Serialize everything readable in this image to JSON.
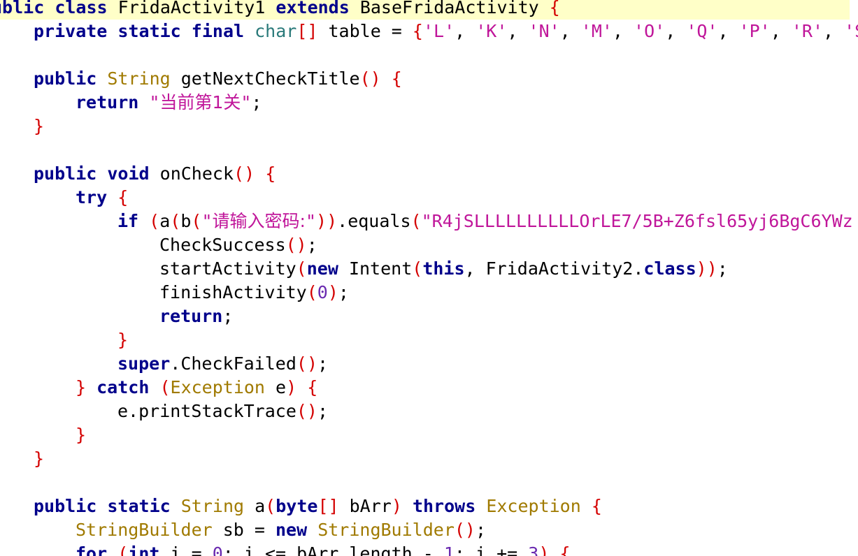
{
  "editor": {
    "colors": {
      "keyword": "#00008b",
      "type": "#a07a00",
      "bracket": "#d40000",
      "string": "#c0169a",
      "number": "#6a2ab0",
      "current_line": "#ffffc8"
    },
    "lines": [
      {
        "indent": "",
        "tokens": [
          {
            "k": "kw",
            "t": "ublic"
          },
          {
            "k": "plain",
            "t": " "
          },
          {
            "k": "kw",
            "t": "class"
          },
          {
            "k": "plain",
            "t": " FridaActivity1 "
          },
          {
            "k": "kw",
            "t": "extends"
          },
          {
            "k": "plain",
            "t": " BaseFridaActivity "
          },
          {
            "k": "brace",
            "t": "{"
          }
        ]
      },
      {
        "indent": "  ",
        "tokens": [
          {
            "k": "kw",
            "t": "private"
          },
          {
            "k": "plain",
            "t": " "
          },
          {
            "k": "kw",
            "t": "static"
          },
          {
            "k": "plain",
            "t": " "
          },
          {
            "k": "kw",
            "t": "final"
          },
          {
            "k": "plain",
            "t": " "
          },
          {
            "k": "teal",
            "t": "char"
          },
          {
            "k": "paren",
            "t": "[]"
          },
          {
            "k": "plain",
            "t": " table = "
          },
          {
            "k": "brace",
            "t": "{"
          },
          {
            "k": "str",
            "t": "'L'"
          },
          {
            "k": "plain",
            "t": ", "
          },
          {
            "k": "str",
            "t": "'K'"
          },
          {
            "k": "plain",
            "t": ", "
          },
          {
            "k": "str",
            "t": "'N'"
          },
          {
            "k": "plain",
            "t": ", "
          },
          {
            "k": "str",
            "t": "'M'"
          },
          {
            "k": "plain",
            "t": ", "
          },
          {
            "k": "str",
            "t": "'O'"
          },
          {
            "k": "plain",
            "t": ", "
          },
          {
            "k": "str",
            "t": "'Q'"
          },
          {
            "k": "plain",
            "t": ", "
          },
          {
            "k": "str",
            "t": "'P'"
          },
          {
            "k": "plain",
            "t": ", "
          },
          {
            "k": "str",
            "t": "'R'"
          },
          {
            "k": "plain",
            "t": ", "
          },
          {
            "k": "str",
            "t": "'S"
          }
        ]
      },
      {
        "indent": "",
        "tokens": []
      },
      {
        "indent": "  ",
        "tokens": [
          {
            "k": "kw",
            "t": "public"
          },
          {
            "k": "plain",
            "t": " "
          },
          {
            "k": "type",
            "t": "String"
          },
          {
            "k": "plain",
            "t": " getNextCheckTitle"
          },
          {
            "k": "paren",
            "t": "()"
          },
          {
            "k": "plain",
            "t": " "
          },
          {
            "k": "brace",
            "t": "{"
          }
        ]
      },
      {
        "indent": "    ",
        "tokens": [
          {
            "k": "kw",
            "t": "return"
          },
          {
            "k": "plain",
            "t": " "
          },
          {
            "k": "str",
            "t": "\""
          },
          {
            "k": "cjk",
            "t": "当前第1关"
          },
          {
            "k": "str",
            "t": "\""
          },
          {
            "k": "plain",
            "t": ";"
          }
        ]
      },
      {
        "indent": "  ",
        "tokens": [
          {
            "k": "brace",
            "t": "}"
          }
        ]
      },
      {
        "indent": "",
        "tokens": []
      },
      {
        "indent": "  ",
        "tokens": [
          {
            "k": "kw",
            "t": "public"
          },
          {
            "k": "plain",
            "t": " "
          },
          {
            "k": "kw",
            "t": "void"
          },
          {
            "k": "plain",
            "t": " onCheck"
          },
          {
            "k": "paren",
            "t": "()"
          },
          {
            "k": "plain",
            "t": " "
          },
          {
            "k": "brace",
            "t": "{"
          }
        ]
      },
      {
        "indent": "    ",
        "tokens": [
          {
            "k": "kw",
            "t": "try"
          },
          {
            "k": "plain",
            "t": " "
          },
          {
            "k": "brace",
            "t": "{"
          }
        ]
      },
      {
        "indent": "      ",
        "tokens": [
          {
            "k": "kw",
            "t": "if"
          },
          {
            "k": "plain",
            "t": " "
          },
          {
            "k": "paren",
            "t": "("
          },
          {
            "k": "plain",
            "t": "a"
          },
          {
            "k": "paren",
            "t": "("
          },
          {
            "k": "plain",
            "t": "b"
          },
          {
            "k": "paren",
            "t": "("
          },
          {
            "k": "str",
            "t": "\""
          },
          {
            "k": "cjk",
            "t": "请输入密码:"
          },
          {
            "k": "str",
            "t": "\""
          },
          {
            "k": "paren",
            "t": "))"
          },
          {
            "k": "plain",
            "t": ".equals"
          },
          {
            "k": "paren",
            "t": "("
          },
          {
            "k": "str",
            "t": "\"R4jSLLLLLLLLLLOrLE7/5B+Z6fsl65yj6BgC6YWz"
          }
        ]
      },
      {
        "indent": "        ",
        "tokens": [
          {
            "k": "plain",
            "t": "CheckSuccess"
          },
          {
            "k": "paren",
            "t": "()"
          },
          {
            "k": "plain",
            "t": ";"
          }
        ]
      },
      {
        "indent": "        ",
        "tokens": [
          {
            "k": "plain",
            "t": "startActivity"
          },
          {
            "k": "paren",
            "t": "("
          },
          {
            "k": "kw",
            "t": "new"
          },
          {
            "k": "plain",
            "t": " Intent"
          },
          {
            "k": "paren",
            "t": "("
          },
          {
            "k": "kw",
            "t": "this"
          },
          {
            "k": "plain",
            "t": ", FridaActivity2."
          },
          {
            "k": "kw",
            "t": "class"
          },
          {
            "k": "paren",
            "t": "))"
          },
          {
            "k": "plain",
            "t": ";"
          }
        ]
      },
      {
        "indent": "        ",
        "tokens": [
          {
            "k": "plain",
            "t": "finishActivity"
          },
          {
            "k": "paren",
            "t": "("
          },
          {
            "k": "num",
            "t": "0"
          },
          {
            "k": "paren",
            "t": ")"
          },
          {
            "k": "plain",
            "t": ";"
          }
        ]
      },
      {
        "indent": "        ",
        "tokens": [
          {
            "k": "kw",
            "t": "return"
          },
          {
            "k": "plain",
            "t": ";"
          }
        ]
      },
      {
        "indent": "      ",
        "tokens": [
          {
            "k": "brace",
            "t": "}"
          }
        ]
      },
      {
        "indent": "      ",
        "tokens": [
          {
            "k": "kw",
            "t": "super"
          },
          {
            "k": "plain",
            "t": ".CheckFailed"
          },
          {
            "k": "paren",
            "t": "()"
          },
          {
            "k": "plain",
            "t": ";"
          }
        ]
      },
      {
        "indent": "    ",
        "tokens": [
          {
            "k": "brace",
            "t": "}"
          },
          {
            "k": "plain",
            "t": " "
          },
          {
            "k": "kw",
            "t": "catch"
          },
          {
            "k": "plain",
            "t": " "
          },
          {
            "k": "paren",
            "t": "("
          },
          {
            "k": "type",
            "t": "Exception"
          },
          {
            "k": "plain",
            "t": " e"
          },
          {
            "k": "paren",
            "t": ")"
          },
          {
            "k": "plain",
            "t": " "
          },
          {
            "k": "brace",
            "t": "{"
          }
        ]
      },
      {
        "indent": "      ",
        "tokens": [
          {
            "k": "plain",
            "t": "e.printStackTrace"
          },
          {
            "k": "paren",
            "t": "()"
          },
          {
            "k": "plain",
            "t": ";"
          }
        ]
      },
      {
        "indent": "    ",
        "tokens": [
          {
            "k": "brace",
            "t": "}"
          }
        ]
      },
      {
        "indent": "  ",
        "tokens": [
          {
            "k": "brace",
            "t": "}"
          }
        ]
      },
      {
        "indent": "",
        "tokens": []
      },
      {
        "indent": "  ",
        "tokens": [
          {
            "k": "kw",
            "t": "public"
          },
          {
            "k": "plain",
            "t": " "
          },
          {
            "k": "kw",
            "t": "static"
          },
          {
            "k": "plain",
            "t": " "
          },
          {
            "k": "type",
            "t": "String"
          },
          {
            "k": "plain",
            "t": " a"
          },
          {
            "k": "paren",
            "t": "("
          },
          {
            "k": "kw",
            "t": "byte"
          },
          {
            "k": "paren",
            "t": "[]"
          },
          {
            "k": "plain",
            "t": " bArr"
          },
          {
            "k": "paren",
            "t": ")"
          },
          {
            "k": "plain",
            "t": " "
          },
          {
            "k": "kw",
            "t": "throws"
          },
          {
            "k": "plain",
            "t": " "
          },
          {
            "k": "type",
            "t": "Exception"
          },
          {
            "k": "plain",
            "t": " "
          },
          {
            "k": "brace",
            "t": "{"
          }
        ]
      },
      {
        "indent": "    ",
        "tokens": [
          {
            "k": "type",
            "t": "StringBuilder"
          },
          {
            "k": "plain",
            "t": " sb = "
          },
          {
            "k": "kw",
            "t": "new"
          },
          {
            "k": "plain",
            "t": " "
          },
          {
            "k": "type",
            "t": "StringBuilder"
          },
          {
            "k": "paren",
            "t": "()"
          },
          {
            "k": "plain",
            "t": ";"
          }
        ]
      },
      {
        "indent": "    ",
        "tokens": [
          {
            "k": "kw",
            "t": "for"
          },
          {
            "k": "plain",
            "t": " "
          },
          {
            "k": "paren",
            "t": "("
          },
          {
            "k": "kw",
            "t": "int"
          },
          {
            "k": "plain",
            "t": " i = "
          },
          {
            "k": "num",
            "t": "0"
          },
          {
            "k": "plain",
            "t": "; i <= bArr.length - "
          },
          {
            "k": "num",
            "t": "1"
          },
          {
            "k": "plain",
            "t": "; i += "
          },
          {
            "k": "num",
            "t": "3"
          },
          {
            "k": "paren",
            "t": ")"
          },
          {
            "k": "plain",
            "t": " "
          },
          {
            "k": "brace",
            "t": "{"
          }
        ]
      }
    ]
  }
}
